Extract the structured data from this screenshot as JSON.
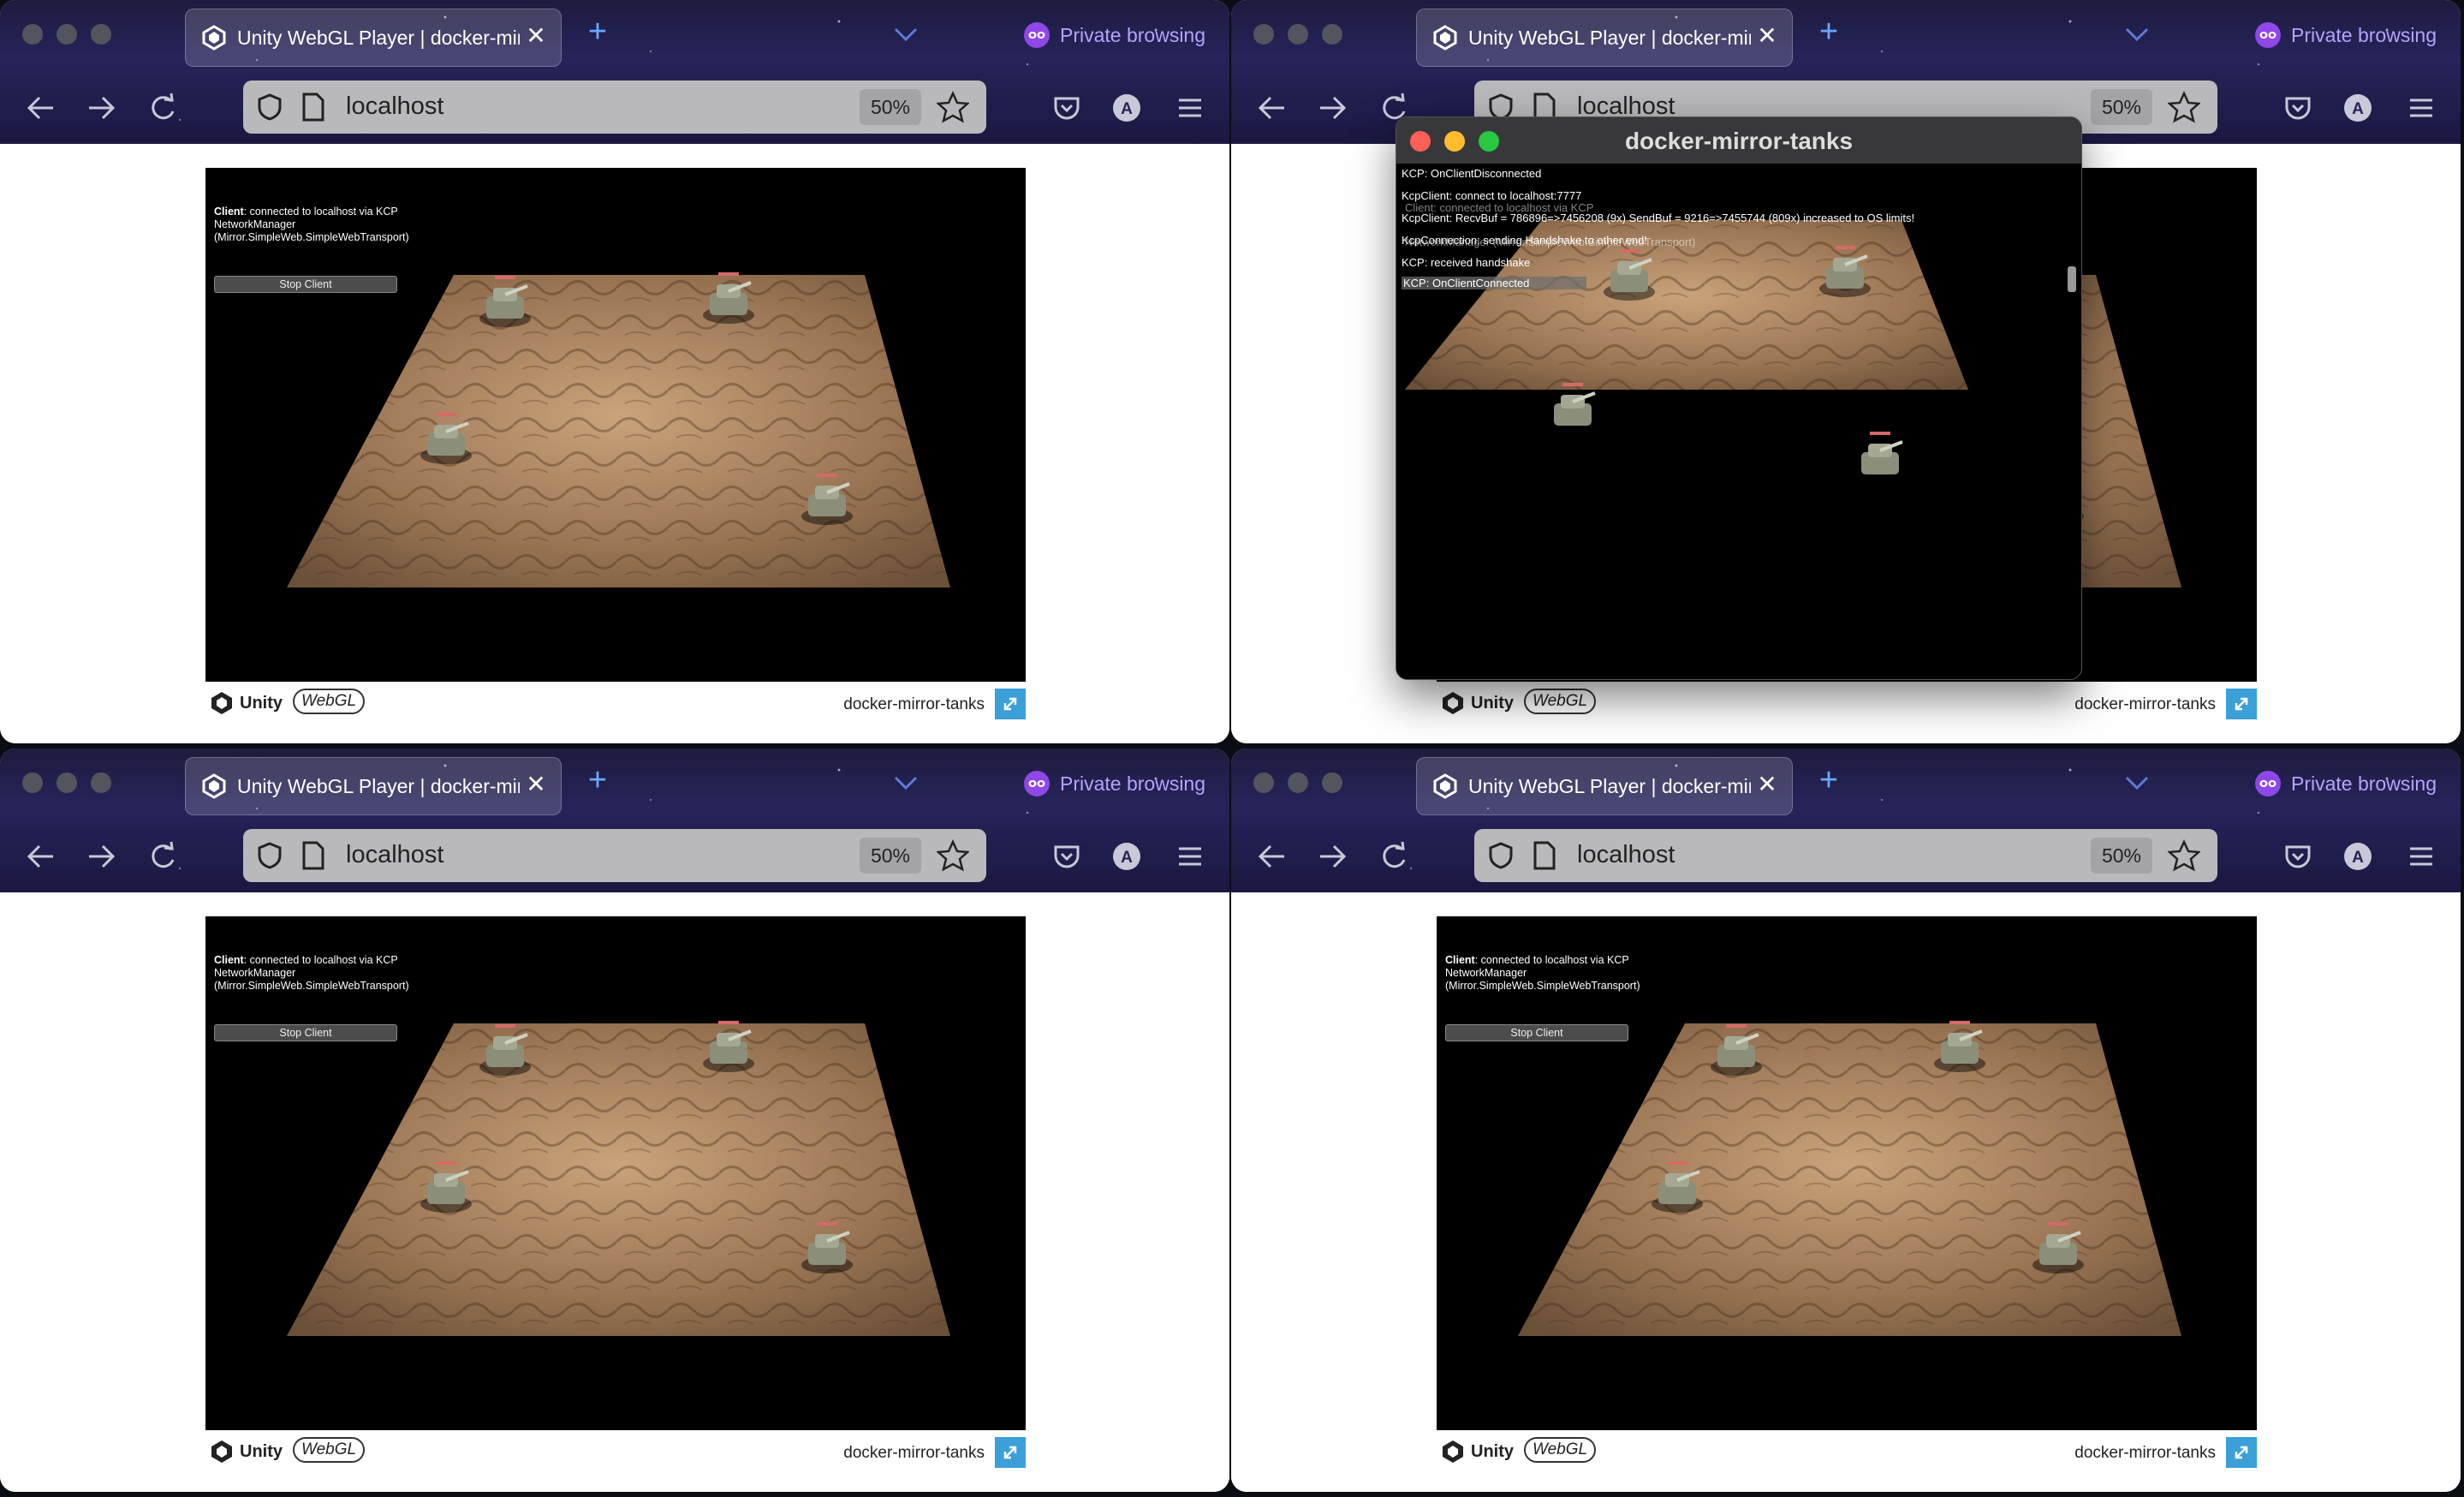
{
  "browser": {
    "tab_title": "Unity WebGL Player | docker-mirror-tanks",
    "private_label": "Private browsing",
    "url": "localhost",
    "zoom": "50%"
  },
  "game": {
    "client_label": "Client",
    "client_status": ": connected to localhost via KCP",
    "network_manager": "NetworkManager (Mirror.SimpleWeb.SimpleWebTransport)",
    "stop_button": "Stop Client"
  },
  "footer": {
    "unity_label": "Unity",
    "webgl_label": "WebGL",
    "title": "docker-mirror-tanks"
  },
  "popup": {
    "title": "docker-mirror-tanks",
    "log_lines": [
      "KCP: OnClientDisconnected",
      "KcpClient: connect to localhost:7777",
      "KcpClient: RecvBuf = 786896=>7456208 (9x) SendBuf = 9216=>7455744 (809x) increased to OS limits!",
      "KcpConnection: sending Handshake to other end!",
      "KCP: received handshake",
      "KCP: OnClientConnected"
    ]
  },
  "colors": {
    "accent_private": "#8f47e8",
    "fullscreen_button": "#3b9fd8"
  }
}
